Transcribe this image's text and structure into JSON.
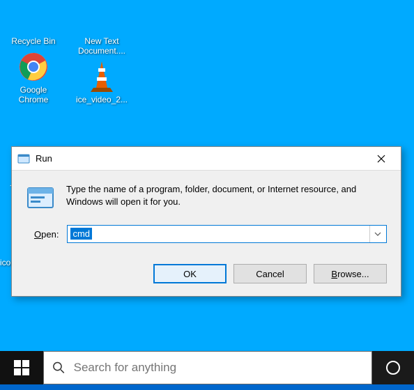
{
  "desktop": {
    "icons": [
      {
        "name": "recycle-bin",
        "label": "Recycle Bin"
      },
      {
        "name": "new-text-document",
        "label": "New Text Document...."
      },
      {
        "name": "google-chrome",
        "label": "Google Chrome"
      },
      {
        "name": "ice-video",
        "label": "ice_video_2..."
      }
    ],
    "partial1": "~",
    "partial2": "ico"
  },
  "run": {
    "title": "Run",
    "description": "Type the name of a program, folder, document, or Internet resource, and Windows will open it for you.",
    "open_label_prefix": "O",
    "open_label_rest": "pen:",
    "value": "cmd",
    "buttons": {
      "ok": "OK",
      "cancel": "Cancel",
      "browse_prefix": "B",
      "browse_rest": "rowse..."
    }
  },
  "taskbar": {
    "search_placeholder": "Search for anything"
  }
}
